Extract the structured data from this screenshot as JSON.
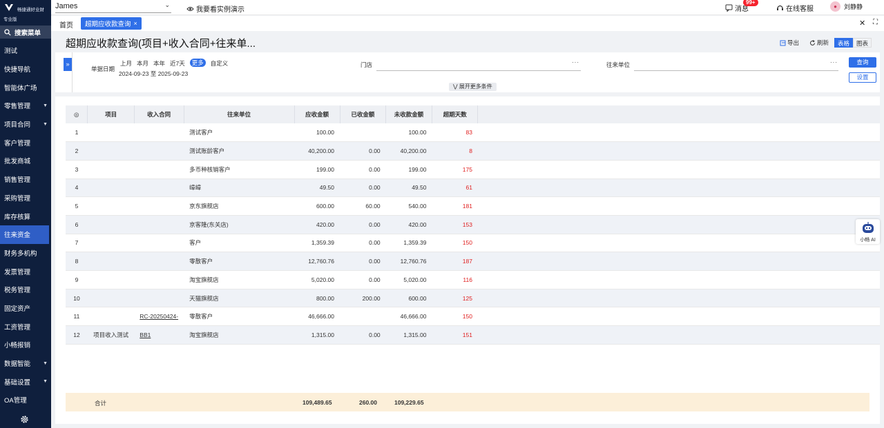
{
  "sidebar": {
    "logo_text": "畅捷通好业财",
    "edition": "专业版",
    "search_label": "搜索菜单",
    "items": [
      {
        "label": "测试",
        "caret": false,
        "active": false
      },
      {
        "label": "快捷导航",
        "caret": false,
        "active": false
      },
      {
        "label": "智能体广场",
        "caret": false,
        "active": false
      },
      {
        "label": "零售管理",
        "caret": true,
        "active": false
      },
      {
        "label": "项目合同",
        "caret": true,
        "active": false
      },
      {
        "label": "客户管理",
        "caret": false,
        "active": false
      },
      {
        "label": "批发商城",
        "caret": false,
        "active": false
      },
      {
        "label": "销售管理",
        "caret": false,
        "active": false
      },
      {
        "label": "采购管理",
        "caret": false,
        "active": false
      },
      {
        "label": "库存核算",
        "caret": false,
        "active": false
      },
      {
        "label": "往来资金",
        "caret": false,
        "active": true
      },
      {
        "label": "财务多机构",
        "caret": false,
        "active": false
      },
      {
        "label": "发票管理",
        "caret": false,
        "active": false
      },
      {
        "label": "税务管理",
        "caret": false,
        "active": false
      },
      {
        "label": "固定资产",
        "caret": false,
        "active": false
      },
      {
        "label": "工资管理",
        "caret": false,
        "active": false
      },
      {
        "label": "小畅报销",
        "caret": false,
        "active": false
      },
      {
        "label": "数据智能",
        "caret": true,
        "active": false
      },
      {
        "label": "基础设置",
        "caret": true,
        "active": false
      },
      {
        "label": "OA管理",
        "caret": false,
        "active": false
      }
    ]
  },
  "topbar": {
    "tenant": "James",
    "demo": "我要看实例演示",
    "messages": "消息",
    "badge": "99+",
    "service": "在线客服",
    "user": "刘静静"
  },
  "tabs": {
    "home": "首页",
    "active": "超期应收款查询"
  },
  "page": {
    "title": "超期应收款查询(项目+收入合同+往来单...",
    "export": "导出",
    "refresh": "刷新",
    "view_table": "表格",
    "view_chart": "图表"
  },
  "filter": {
    "date_label": "单据日期",
    "quick": [
      "上月",
      "本月",
      "本年",
      "近7天",
      "更多",
      "自定义"
    ],
    "quick_selected": "更多",
    "date_range": "2024-09-23 至 2025-09-23",
    "store_label": "门店",
    "partner_label": "往来单位",
    "query": "查询",
    "settings": "设置",
    "more_conditions": "展开更多条件"
  },
  "table": {
    "columns": [
      "项目",
      "收入合同",
      "往来单位",
      "应收金额",
      "已收金额",
      "未收款金额",
      "超期天数"
    ],
    "rows": [
      {
        "no": "1",
        "project": "",
        "contract": "",
        "partner": "测试客户",
        "receivable": "100.00",
        "received": "",
        "unreceived": "100.00",
        "overdue": "83"
      },
      {
        "no": "2",
        "project": "",
        "contract": "",
        "partner": "测试账龄客户",
        "receivable": "40,200.00",
        "received": "0.00",
        "unreceived": "40,200.00",
        "overdue": "8"
      },
      {
        "no": "3",
        "project": "",
        "contract": "",
        "partner": "多币种核销客户",
        "receivable": "199.00",
        "received": "0.00",
        "unreceived": "199.00",
        "overdue": "175"
      },
      {
        "no": "4",
        "project": "",
        "contract": "",
        "partner": "嶂嶂",
        "receivable": "49.50",
        "received": "0.00",
        "unreceived": "49.50",
        "overdue": "61"
      },
      {
        "no": "5",
        "project": "",
        "contract": "",
        "partner": "京东旗舰店",
        "receivable": "600.00",
        "received": "60.00",
        "unreceived": "540.00",
        "overdue": "181"
      },
      {
        "no": "6",
        "project": "",
        "contract": "",
        "partner": "京客隆(东关店)",
        "receivable": "420.00",
        "received": "0.00",
        "unreceived": "420.00",
        "overdue": "153"
      },
      {
        "no": "7",
        "project": "",
        "contract": "",
        "partner": "客户",
        "receivable": "1,359.39",
        "received": "0.00",
        "unreceived": "1,359.39",
        "overdue": "150"
      },
      {
        "no": "8",
        "project": "",
        "contract": "",
        "partner": "零散客户",
        "receivable": "12,760.76",
        "received": "0.00",
        "unreceived": "12,760.76",
        "overdue": "187"
      },
      {
        "no": "9",
        "project": "",
        "contract": "",
        "partner": "淘宝旗舰店",
        "receivable": "5,020.00",
        "received": "0.00",
        "unreceived": "5,020.00",
        "overdue": "116"
      },
      {
        "no": "10",
        "project": "",
        "contract": "",
        "partner": "天猫旗舰店",
        "receivable": "800.00",
        "received": "200.00",
        "unreceived": "600.00",
        "overdue": "125"
      },
      {
        "no": "11",
        "project": "",
        "contract": "RC-20250424-",
        "partner": "零散客户",
        "receivable": "46,666.00",
        "received": "",
        "unreceived": "46,666.00",
        "overdue": "150"
      },
      {
        "no": "12",
        "project": "项目收入测试",
        "contract": "BB1",
        "partner": "淘宝旗舰店",
        "receivable": "1,315.00",
        "received": "0.00",
        "unreceived": "1,315.00",
        "overdue": "151"
      }
    ],
    "total_label": "合计",
    "total_receivable": "109,489.65",
    "total_received": "260.00",
    "total_unreceived": "109,229.65"
  },
  "assistant": "小畅 AI"
}
